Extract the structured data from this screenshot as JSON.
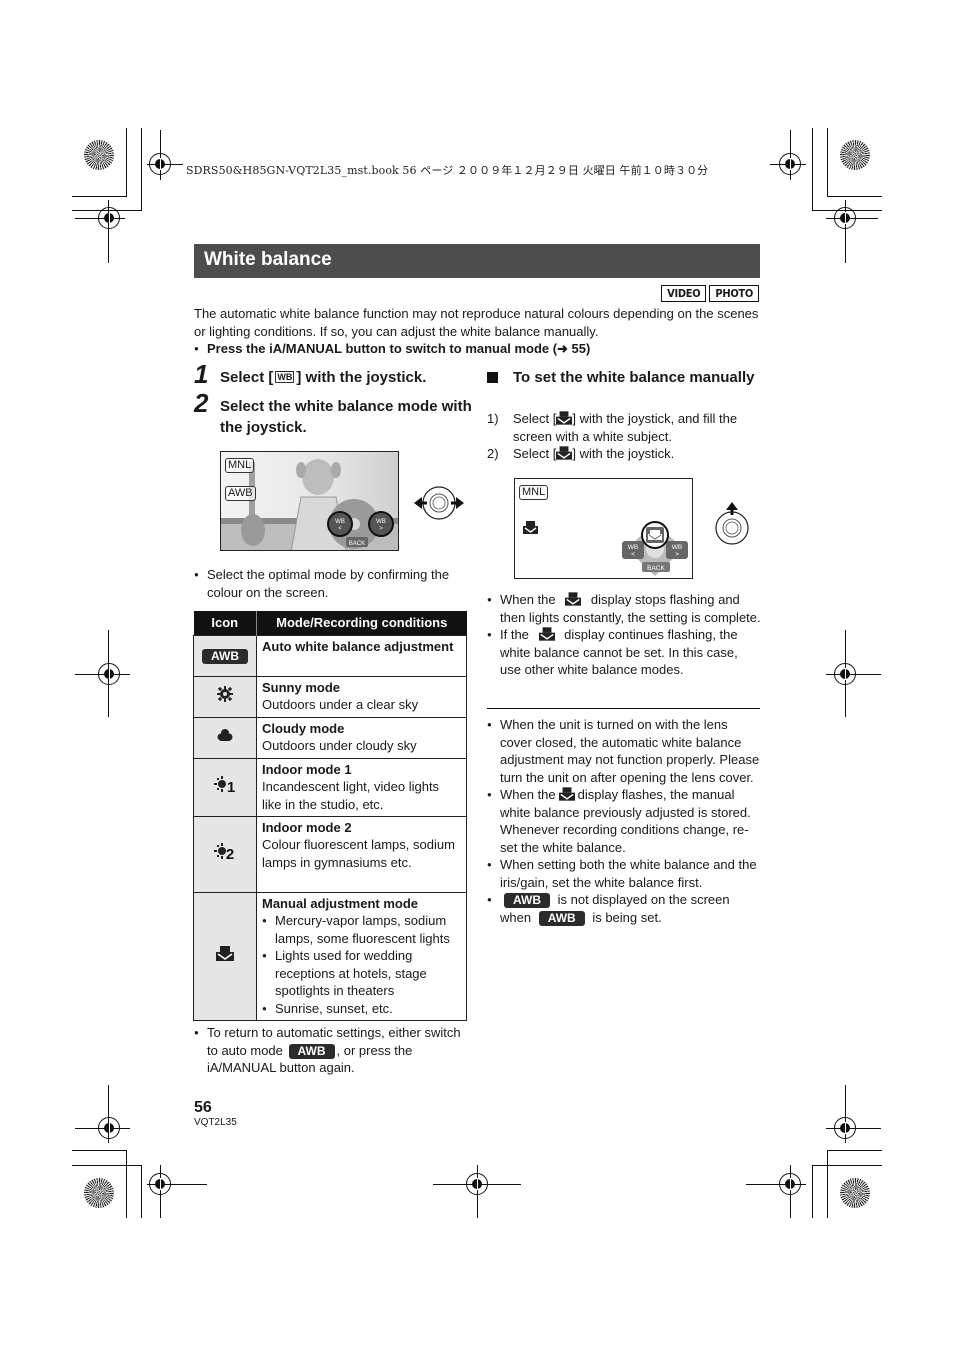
{
  "print_header": "SDRS50&H85GN-VQT2L35_mst.book  56 ページ  ２００９年１２月２９日  火曜日  午前１０時３０分",
  "title": "White balance",
  "mode_tags": [
    "VIDEO",
    "PHOTO"
  ],
  "intro": {
    "text": "The automatic white balance function may not reproduce natural colours depending on the scenes or lighting conditions. If so, you can adjust the white balance manually.",
    "bullet": "Press the iA/MANUAL button to switch to manual mode (➜ 55)"
  },
  "steps": [
    {
      "num": "1",
      "before": "Select [",
      "icon": "WB",
      "after": "] with the joystick."
    },
    {
      "num": "2",
      "text": "Select the white balance mode with the joystick."
    }
  ],
  "screen1": {
    "osd_top": "MNL",
    "osd_mode": "AWB",
    "btn_left": "WB <",
    "btn_right": "WB >",
    "btn_back": "BACK"
  },
  "screen2": {
    "osd_top": "MNL",
    "btn_left": "WB <",
    "btn_right": "WB >",
    "btn_back": "BACK"
  },
  "left_note": "Select the optimal mode by confirming the colour on the screen.",
  "table": {
    "headers": [
      "Icon",
      "Mode/Recording conditions"
    ],
    "rows": [
      {
        "icon": "AWB",
        "icon_name": "awb-icon",
        "mode": "Auto white balance adjustment",
        "desc": ""
      },
      {
        "icon": "☀",
        "icon_name": "sunny-icon",
        "mode": "Sunny mode",
        "desc": "Outdoors under a clear sky"
      },
      {
        "icon": "☁",
        "icon_name": "cloudy-icon",
        "mode": "Cloudy mode",
        "desc": "Outdoors under cloudy sky"
      },
      {
        "icon": "✲1",
        "icon_name": "indoor1-icon",
        "mode": "Indoor mode 1",
        "desc": "Incandescent light, video lights like in the studio, etc."
      },
      {
        "icon": "✲2",
        "icon_name": "indoor2-icon",
        "mode": "Indoor mode 2",
        "desc": "Colour fluorescent lamps, sodium lamps in gymnasiums etc."
      },
      {
        "icon": "manual",
        "icon_name": "manual-wb-icon",
        "mode": "Manual adjustment mode",
        "bullets": [
          "Mercury-vapor lamps, sodium lamps, some fluorescent lights",
          "Lights used for wedding receptions at hotels, stage spotlights in theaters",
          "Sunrise, sunset, etc."
        ]
      }
    ]
  },
  "return_note": {
    "before": "To return to automatic settings, either switch to auto mode",
    "badge": "AWB",
    "after": ", or press the iA/MANUAL button again."
  },
  "manual_section": {
    "heading": "To set the white balance manually",
    "items": [
      {
        "n": "1)",
        "before": "Select [",
        "after": "] with the joystick, and fill the screen with a white subject."
      },
      {
        "n": "2)",
        "before": "Select [",
        "after": "] with the joystick."
      }
    ],
    "notes": [
      {
        "before": "When the",
        "after": "display stops flashing and then lights constantly, the setting is complete."
      },
      {
        "before": "If the",
        "after": "display continues flashing, the white balance cannot be set. In this case, use other white balance modes."
      }
    ]
  },
  "general_notes": [
    {
      "text": "When the unit is turned on with the lens cover closed, the automatic white balance adjustment may not function properly. Please turn the unit on after opening the lens cover."
    },
    {
      "before": "When the",
      "after": "display flashes, the manual white balance previously adjusted is stored. Whenever recording conditions change, re-set the white balance."
    },
    {
      "text": "When setting both the white balance and the iris/gain, set the white balance first."
    },
    {
      "badge1": "AWB",
      "middle": "is not displayed on the screen when",
      "badge2": "AWB",
      "after": "is being set."
    }
  ],
  "footer": {
    "page": "56",
    "code": "VQT2L35"
  }
}
